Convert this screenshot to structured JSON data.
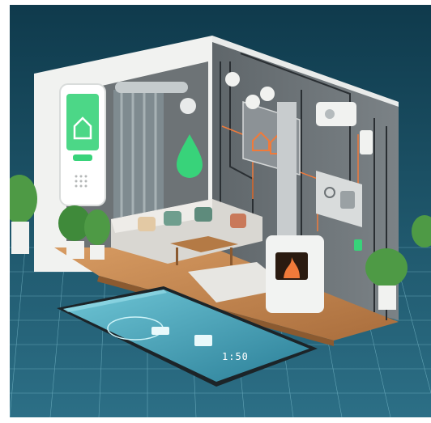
{
  "image": {
    "description_free": true,
    "phone_screen": {
      "time_text": "1:50",
      "accent_color": "#7fd9e8",
      "screen_color": "#2a8fa6"
    },
    "colors": {
      "sky_top": "#0f3a4c",
      "sky_bottom": "#2c6f86",
      "grid_line": "#8fd0df",
      "wall_white": "#f1f2f0",
      "wall_gray": "#6d7376",
      "floor_wood": "#c58a54",
      "green_glow": "#38d37a",
      "orange_glow": "#f07a3a"
    },
    "icons": [
      "house-icon",
      "water-drop-icon",
      "home-control-icon",
      "thermostat-icon",
      "fireplace-icon",
      "plant-icon",
      "sofa-icon",
      "smartphone-icon"
    ]
  }
}
